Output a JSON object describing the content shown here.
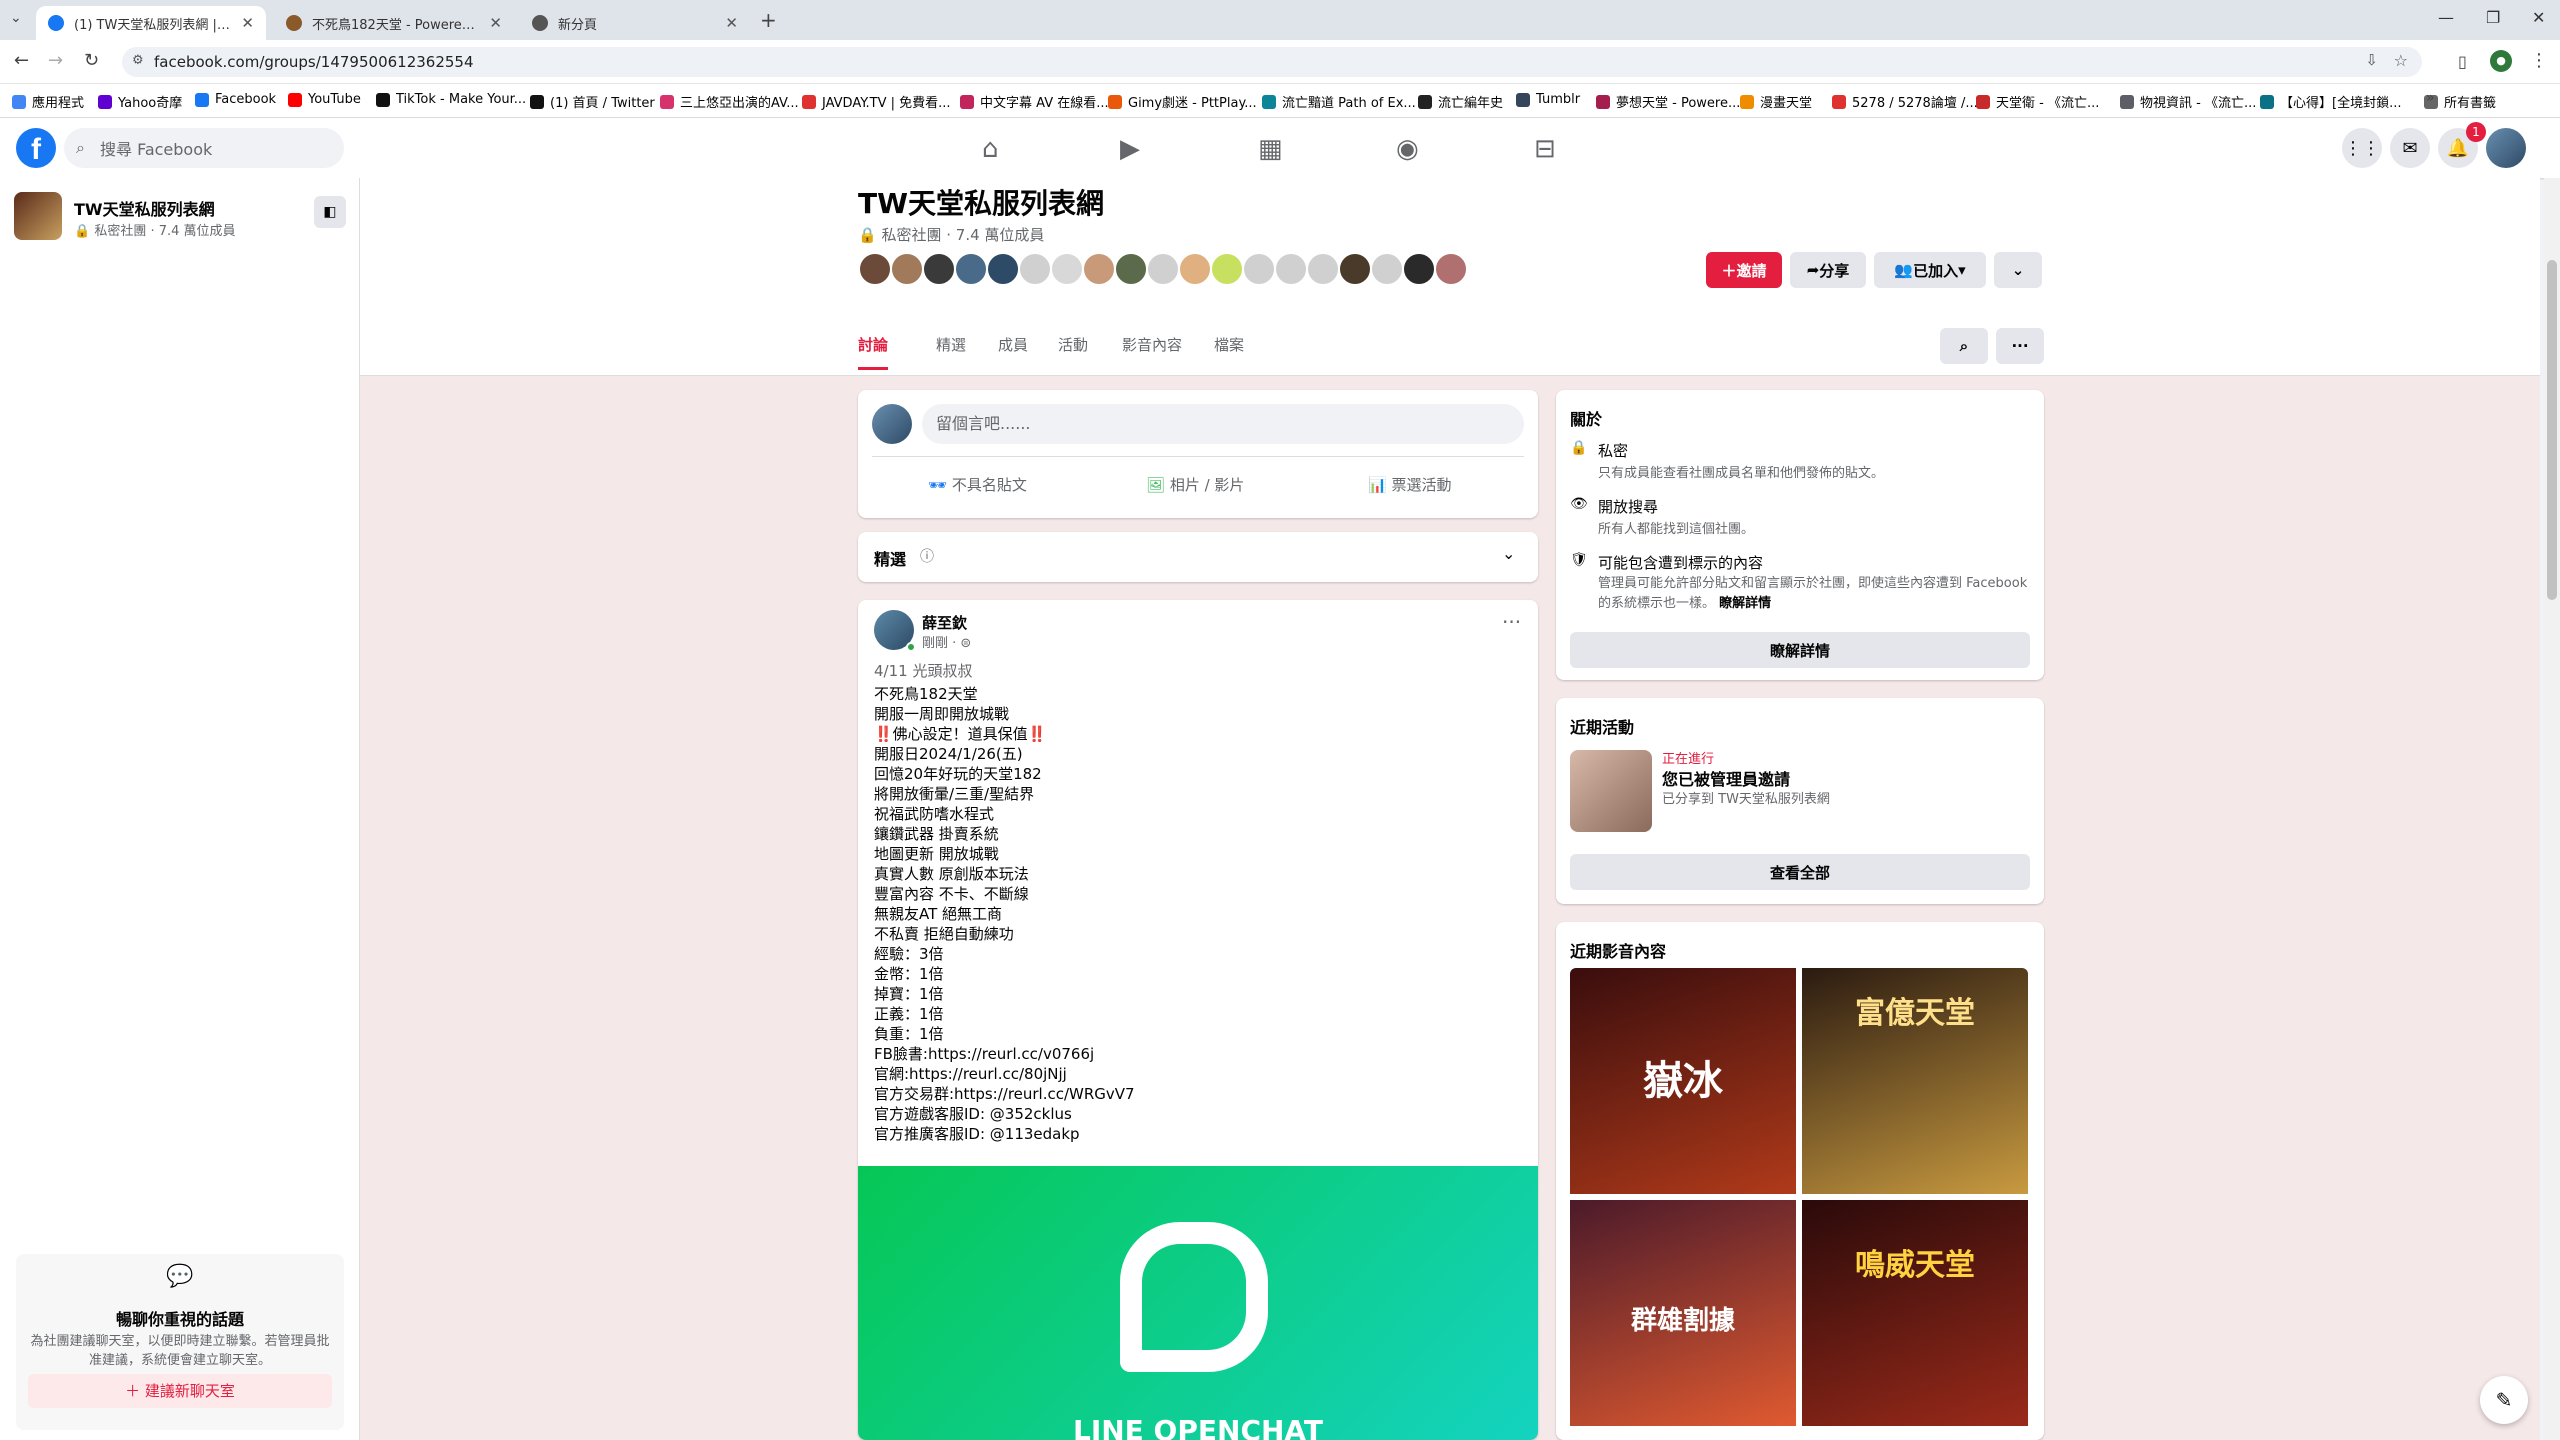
{
  "browser": {
    "tabs": [
      {
        "title": "(1) TW天堂私服列表網 | Facebook",
        "active": true,
        "fav_color": "#1877f2"
      },
      {
        "title": "不死鳥182天堂 - Powered by Discuz!",
        "active": false,
        "fav_color": "#8a5a2b"
      },
      {
        "title": "新分頁",
        "active": false,
        "fav_color": "#555555"
      }
    ],
    "url": "facebook.com/groups/1479500612362554",
    "bookmarks": [
      {
        "label": "應用程式",
        "color": "#4285f4"
      },
      {
        "label": "Yahoo奇摩",
        "color": "#6001d2"
      },
      {
        "label": "Facebook",
        "color": "#1877f2"
      },
      {
        "label": "YouTube",
        "color": "#ff0000"
      },
      {
        "label": "TikTok - Make Your...",
        "color": "#111111"
      },
      {
        "label": "(1) 首頁 / Twitter",
        "color": "#111111"
      },
      {
        "label": "三上悠亞出演的AV...",
        "color": "#d6336c"
      },
      {
        "label": "JAVDAY.TV | 免費看...",
        "color": "#e03131"
      },
      {
        "label": "中文字幕 AV 在線看...",
        "color": "#c2255c"
      },
      {
        "label": "Gimy劇迷 - PttPlay...",
        "color": "#e8590c"
      },
      {
        "label": "流亡黯道 Path of Ex...",
        "color": "#0c8599"
      },
      {
        "label": "流亡編年史",
        "color": "#222222"
      },
      {
        "label": "Tumblr",
        "color": "#35465c"
      },
      {
        "label": "夢想天堂 - Powere...",
        "color": "#a61e4d"
      },
      {
        "label": "漫畫天堂",
        "color": "#f08c00"
      },
      {
        "label": "5278 / 5278論壇 /...",
        "color": "#e03131"
      },
      {
        "label": "天堂衛 - 《流亡...",
        "color": "#c92a2a"
      },
      {
        "label": "物視資訊 - 《流亡...",
        "color": "#5c5f66"
      },
      {
        "label": "【心得】[全境封鎖...",
        "color": "#0b7285"
      }
    ],
    "all_bookmarks": "所有書籤"
  },
  "fb": {
    "search_placeholder": "搜尋 Facebook",
    "notif_count": "1"
  },
  "sidebar": {
    "group_name": "TW天堂私服列表網",
    "group_meta": "私密社團 · 7.4 萬位成員",
    "chat_title": "暢聊你重視的話題",
    "chat_desc": "為社團建議聊天室，以便即時建立聯繫。若管理員批准建議，系統便會建立聊天室。",
    "chat_button": "建議新聊天室"
  },
  "group": {
    "title": "TW天堂私服列表網",
    "meta": "私密社團 · 7.4 萬位成員",
    "invite": "邀請",
    "share": "分享",
    "joined": "已加入",
    "tabs": [
      "討論",
      "精選",
      "成員",
      "活動",
      "影音內容",
      "檔案"
    ]
  },
  "composer": {
    "placeholder": "留個言吧......",
    "anon": "不具名貼文",
    "photo": "相片 / 影片",
    "poll": "票選活動"
  },
  "featured": {
    "label": "精選"
  },
  "post": {
    "author": "薛至欽",
    "time": "剛剛 ·",
    "subtitle": "4/11 光頭叔叔",
    "lines": [
      "不死鳥182天堂",
      "開服一周即開放城戰",
      "‼️佛心設定！道具保值‼️",
      "開服日2024/1/26(五)",
      "回憶20年好玩的天堂182",
      "將開放衝暈/三重/聖結界",
      "祝福武防嗜水程式",
      "鑲鑽武器 掛賣系統",
      "地圖更新 開放城戰",
      "真實人數 原創版本玩法",
      "豐富內容 不卡、不斷線",
      "無親友AT 絕無工商",
      "不私賣 拒絕自動練功",
      "經驗：3倍",
      "金幣：1倍",
      "掉寶：1倍",
      "正義：1倍",
      "負重：1倍",
      "FB臉書:https://reurl.cc/v0766j",
      "官網:https://reurl.cc/80jNjj",
      "官方交易群:https://reurl.cc/WRGvV7",
      "官方遊戲客服ID: @352cklus",
      "官方推廣客服ID: @113edakp"
    ],
    "banner_text": "LINE OPENCHAT"
  },
  "about": {
    "title": "關於",
    "private_title": "私密",
    "private_desc": "只有成員能查看社團成員名單和他們發佈的貼文。",
    "search_title": "開放搜尋",
    "search_desc": "所有人都能找到這個社團。",
    "flag_title": "可能包含遭到標示的內容",
    "flag_desc": "管理員可能允許部分貼文和留言顯示於社團，即使這些內容遭到 Facebook 的系統標示也一樣。",
    "flag_link": "瞭解詳情",
    "learn_more_btn": "瞭解詳情"
  },
  "activity": {
    "title": "近期活動",
    "status": "正在進行",
    "headline": "您已被管理員邀請",
    "sub": "已分享到 TW天堂私服列表網",
    "see_all": "查看全部"
  },
  "media": {
    "title": "近期影音內容",
    "thumbs": [
      {
        "caption": "嶽冰",
        "colors": [
          "#3a0d0d",
          "#b03a1a"
        ]
      },
      {
        "caption": "富億天堂",
        "colors": [
          "#2a1a10",
          "#c89a40"
        ]
      },
      {
        "caption": "群雄割據",
        "colors": [
          "#4b1a2a",
          "#e05a30"
        ]
      },
      {
        "caption": "鳴威天堂",
        "colors": [
          "#2a0a0a",
          "#9a2a1a"
        ]
      }
    ]
  }
}
